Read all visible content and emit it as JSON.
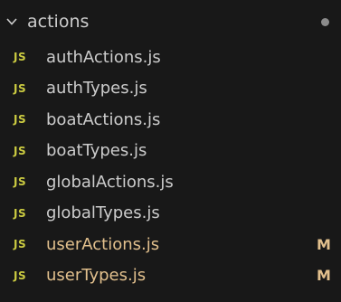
{
  "colors": {
    "background": "#181818",
    "text": "#cccccc",
    "js_icon": "#cbcb41",
    "modified_text": "#e2c08d",
    "folder_dot": "#8b8b8b"
  },
  "folder": {
    "name": "actions",
    "chevron_icon": "chevron-down-icon",
    "expanded": true
  },
  "files": [
    {
      "icon_label": "JS",
      "icon": "javascript-file-icon",
      "name": "authActions.js",
      "status": ""
    },
    {
      "icon_label": "JS",
      "icon": "javascript-file-icon",
      "name": "authTypes.js",
      "status": ""
    },
    {
      "icon_label": "JS",
      "icon": "javascript-file-icon",
      "name": "boatActions.js",
      "status": ""
    },
    {
      "icon_label": "JS",
      "icon": "javascript-file-icon",
      "name": "boatTypes.js",
      "status": ""
    },
    {
      "icon_label": "JS",
      "icon": "javascript-file-icon",
      "name": "globalActions.js",
      "status": ""
    },
    {
      "icon_label": "JS",
      "icon": "javascript-file-icon",
      "name": "globalTypes.js",
      "status": ""
    },
    {
      "icon_label": "JS",
      "icon": "javascript-file-icon",
      "name": "userActions.js",
      "status": "M"
    },
    {
      "icon_label": "JS",
      "icon": "javascript-file-icon",
      "name": "userTypes.js",
      "status": "M"
    }
  ]
}
